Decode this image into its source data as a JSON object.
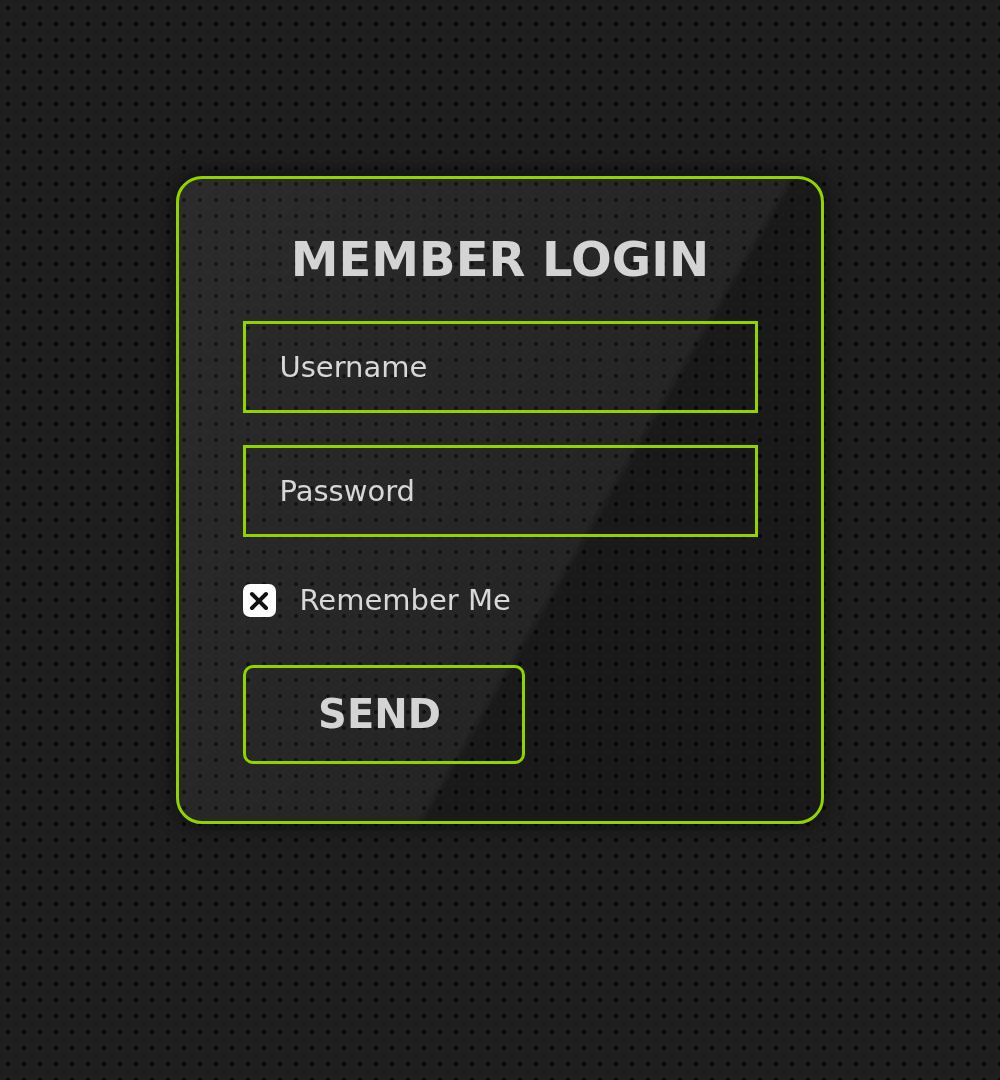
{
  "title": "MEMBER LOGIN",
  "fields": [
    {
      "placeholder": "Username"
    },
    {
      "placeholder": "Password"
    }
  ],
  "remember": {
    "label": "Remember Me",
    "checked": true
  },
  "button": "SEND"
}
